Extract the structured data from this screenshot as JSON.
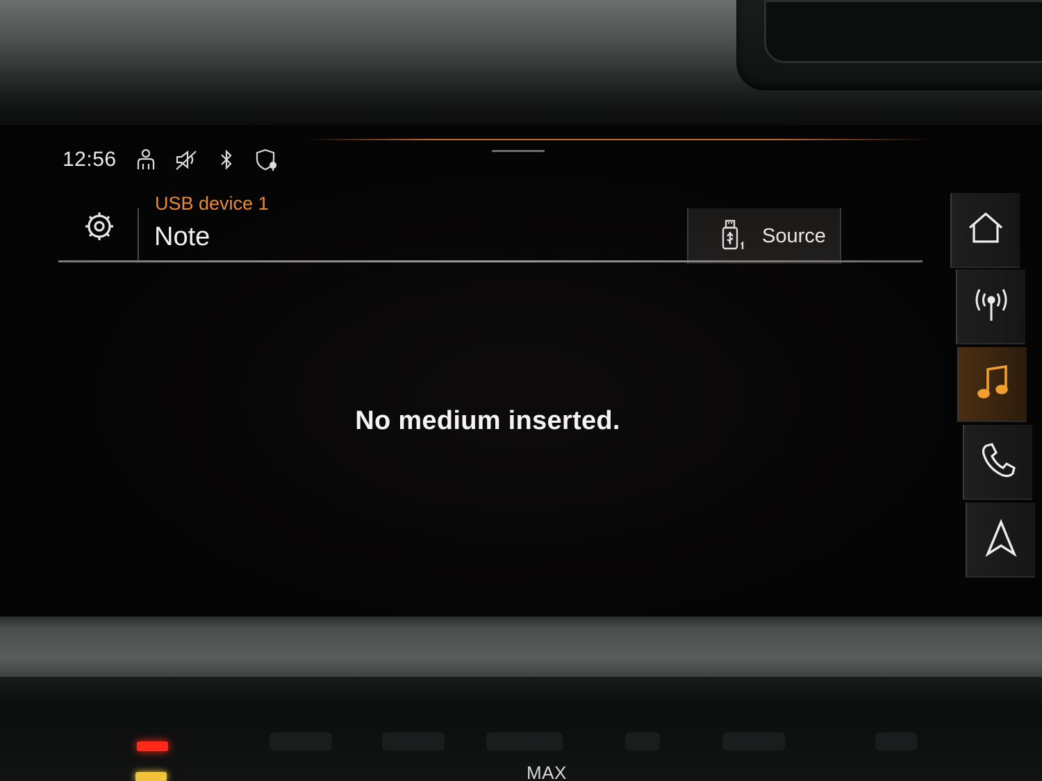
{
  "status_bar": {
    "time": "12:56",
    "icons": [
      "person-icon",
      "speaker-muted-icon",
      "bluetooth-icon",
      "shield-location-icon"
    ]
  },
  "header": {
    "settings_icon": "gear-icon",
    "source_line": "USB device 1",
    "title": "Note",
    "source_button": {
      "icon": "usb-stick-icon",
      "label": "Source"
    }
  },
  "main": {
    "message": "No medium inserted."
  },
  "right_nav": {
    "items": [
      {
        "icon": "home-icon",
        "active": false
      },
      {
        "icon": "radio-icon",
        "active": false
      },
      {
        "icon": "music-note-icon",
        "active": true
      },
      {
        "icon": "phone-icon",
        "active": false
      },
      {
        "icon": "navigation-icon",
        "active": false
      }
    ]
  },
  "dashboard": {
    "climate_label": "MAX"
  },
  "colors": {
    "accent": "#e98a34",
    "text": "#f2f2f2",
    "background": "#060505"
  }
}
